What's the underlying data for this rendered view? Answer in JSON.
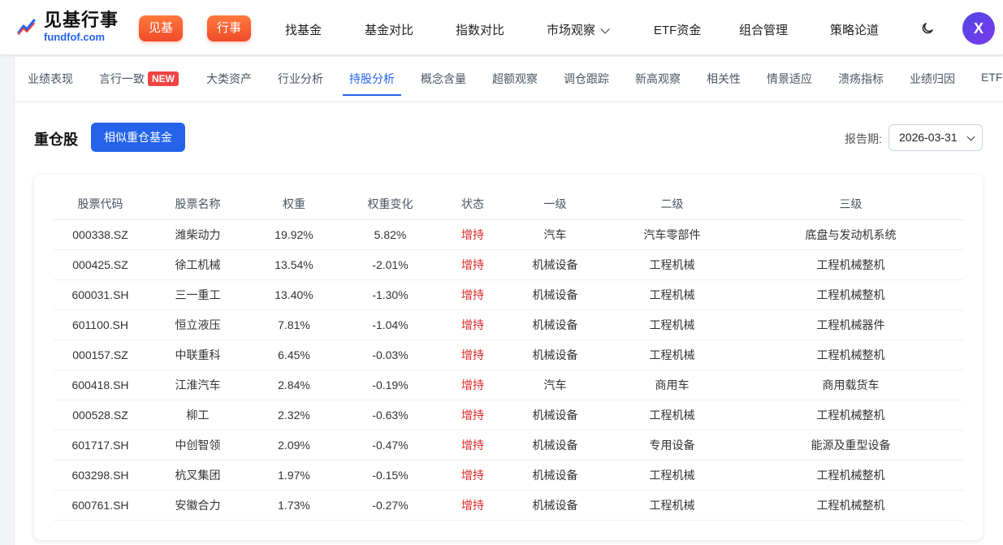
{
  "brand": {
    "name_cn": "见基行事",
    "name_en": "fundfof.com"
  },
  "header": {
    "pills": [
      "见基",
      "行事"
    ],
    "nav": [
      "找基金",
      "基金对比",
      "指数对比",
      "市场观察",
      "ETF资金",
      "组合管理",
      "策略论道"
    ],
    "avatar_initial": "X",
    "icons": {
      "theme": "moon-icon",
      "dropdown": "chevron-down-icon",
      "logo": "trend-chart-icon"
    }
  },
  "tabs": {
    "items": [
      "业绩表现",
      "言行一致",
      "大类资产",
      "行业分析",
      "持股分析",
      "概念含量",
      "超额观察",
      "调仓跟踪",
      "新高观察",
      "相关性",
      "情景适应",
      "溃疡指标",
      "业绩归因",
      "ETF"
    ],
    "active": "持股分析",
    "new_badge": "NEW"
  },
  "section": {
    "title": "重仓股",
    "similar_button": "相似重仓基金",
    "report_label": "报告期:",
    "report_value": "2026-03-31"
  },
  "table": {
    "headers": [
      "股票代码",
      "股票名称",
      "权重",
      "权重变化",
      "状态",
      "一级",
      "二级",
      "三级"
    ],
    "rows": [
      [
        "000338.SZ",
        "潍柴动力",
        "19.92%",
        "5.82%",
        "增持",
        "汽车",
        "汽车零部件",
        "底盘与发动机系统"
      ],
      [
        "000425.SZ",
        "徐工机械",
        "13.54%",
        "-2.01%",
        "增持",
        "机械设备",
        "工程机械",
        "工程机械整机"
      ],
      [
        "600031.SH",
        "三一重工",
        "13.40%",
        "-1.30%",
        "增持",
        "机械设备",
        "工程机械",
        "工程机械整机"
      ],
      [
        "601100.SH",
        "恒立液压",
        "7.81%",
        "-1.04%",
        "增持",
        "机械设备",
        "工程机械",
        "工程机械器件"
      ],
      [
        "000157.SZ",
        "中联重科",
        "6.45%",
        "-0.03%",
        "增持",
        "机械设备",
        "工程机械",
        "工程机械整机"
      ],
      [
        "600418.SH",
        "江淮汽车",
        "2.84%",
        "-0.19%",
        "增持",
        "汽车",
        "商用车",
        "商用载货车"
      ],
      [
        "000528.SZ",
        "柳工",
        "2.32%",
        "-0.63%",
        "增持",
        "机械设备",
        "工程机械",
        "工程机械整机"
      ],
      [
        "601717.SH",
        "中创智领",
        "2.09%",
        "-0.47%",
        "增持",
        "机械设备",
        "专用设备",
        "能源及重型设备"
      ],
      [
        "603298.SH",
        "杭叉集团",
        "1.97%",
        "-0.15%",
        "增持",
        "机械设备",
        "工程机械",
        "工程机械整机"
      ],
      [
        "600761.SH",
        "安徽合力",
        "1.73%",
        "-0.27%",
        "增持",
        "机械设备",
        "工程机械",
        "工程机械整机"
      ]
    ]
  },
  "colors": {
    "accent": "#2563eb",
    "pill": "#f04a2a",
    "status": "#dc2626",
    "badge": "#ef4444"
  }
}
